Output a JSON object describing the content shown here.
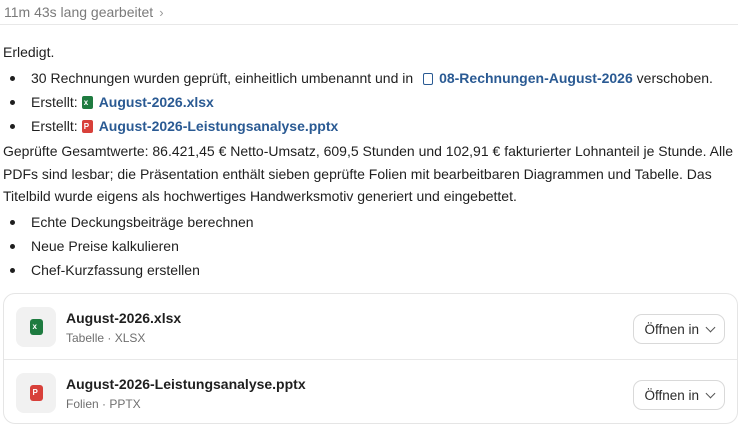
{
  "header": {
    "status": "11m 43s lang gearbeitet",
    "chevron": "›"
  },
  "message": {
    "done": "Erledigt.",
    "bullets1": {
      "moved_prefix": "30 Rechnungen wurden geprüft, einheitlich umbenannt und in",
      "folder": "08-Rechnungen-August-2026",
      "moved_suffix": "verschoben.",
      "created_label": "Erstellt:",
      "file1": "August-2026.xlsx",
      "file2": "August-2026-Leistungsanalyse.pptx"
    },
    "paragraph": "Geprüfte Gesamtwerte: 86.421,45 € Netto-Umsatz, 609,5 Stunden und 102,91 € fakturierter Lohnanteil je Stunde. Alle PDFs sind lesbar; die Präsentation enthält sieben geprüfte Folien mit bearbeitbaren Diagrammen und Tabelle. Das Titelbild wurde eigens als hochwertiges Handwerksmotiv generiert und eingebettet.",
    "suggestions": [
      "Echte Deckungsbeiträge berechnen",
      "Neue Preise kalkulieren",
      "Chef-Kurzfassung erstellen"
    ]
  },
  "files": [
    {
      "name": "August-2026.xlsx",
      "type": "Tabelle · XLSX",
      "icon": "excel-file-icon",
      "open": "Öffnen in"
    },
    {
      "name": "August-2026-Leistungsanalyse.pptx",
      "type": "Folien · PPTX",
      "icon": "powerpoint-file-icon",
      "open": "Öffnen in"
    }
  ],
  "colors": {
    "link": "#2a5a93",
    "excel": "#1e7b40",
    "powerpoint": "#d8403a"
  }
}
